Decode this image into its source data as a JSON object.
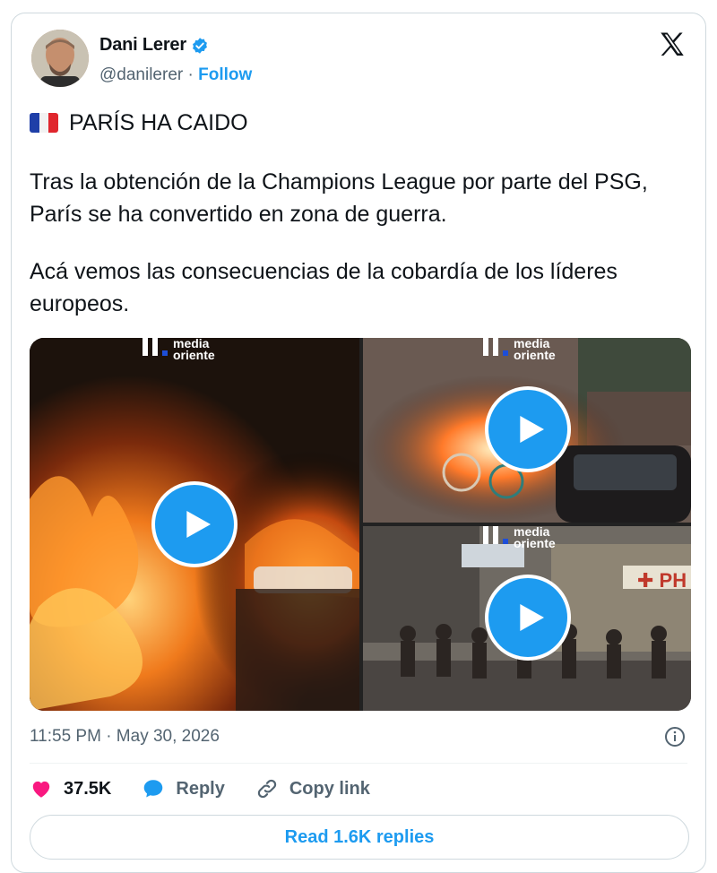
{
  "author": {
    "name": "Dani Lerer",
    "handle": "@danilerer",
    "separator": "·",
    "follow_label": "Follow"
  },
  "tweet": {
    "title": "PARÍS HA CAIDO",
    "paragraph1": "Tras la obtención de la Champions League por parte del PSG, París se ha convertido en zona de guerra.",
    "paragraph2": "Acá vemos las consecuencias de la cobardía de los líderes europeos.",
    "timestamp": "11:55 PM · May 30, 2026"
  },
  "media": {
    "watermark_line1": "media",
    "watermark_line2": "oriente",
    "store_sign": "PH"
  },
  "actions": {
    "likes": "37.5K",
    "reply_label": "Reply",
    "copy_link_label": "Copy link",
    "read_replies_label": "Read 1.6K replies"
  },
  "colors": {
    "accent": "#1d9bf0",
    "like": "#f91880",
    "muted": "#536471"
  }
}
